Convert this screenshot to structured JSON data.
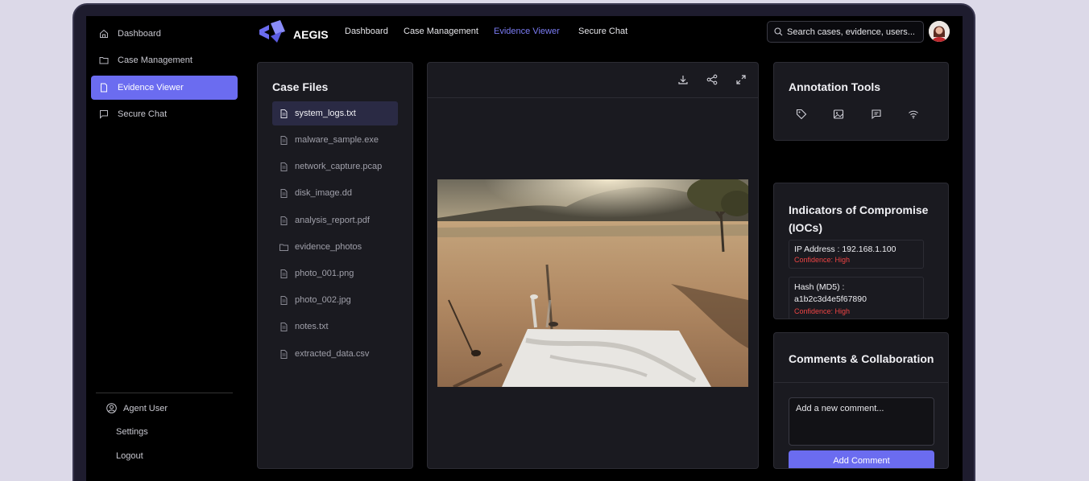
{
  "sidebar": {
    "items": [
      {
        "label": "Dashboard",
        "icon": "home-icon"
      },
      {
        "label": "Case Management",
        "icon": "folder-icon"
      },
      {
        "label": "Evidence Viewer",
        "icon": "file-icon"
      },
      {
        "label": "Secure Chat",
        "icon": "chat-icon"
      }
    ],
    "user": "Agent User",
    "settings": "Settings",
    "logout": "Logout"
  },
  "header": {
    "brand": "AEGIS",
    "nav": [
      "Dashboard",
      "Case Management",
      "Evidence Viewer",
      "Secure Chat"
    ],
    "active_nav": "Evidence Viewer",
    "search_placeholder": "Search cases, evidence, users..."
  },
  "case_files": {
    "title": "Case Files",
    "files": [
      {
        "name": "system_logs.txt",
        "type": "file"
      },
      {
        "name": "malware_sample.exe",
        "type": "file"
      },
      {
        "name": "network_capture.pcap",
        "type": "file"
      },
      {
        "name": "disk_image.dd",
        "type": "file"
      },
      {
        "name": "analysis_report.pdf",
        "type": "file"
      },
      {
        "name": "evidence_photos",
        "type": "folder"
      },
      {
        "name": "photo_001.png",
        "type": "file"
      },
      {
        "name": "photo_002.jpg",
        "type": "file"
      },
      {
        "name": "notes.txt",
        "type": "file"
      },
      {
        "name": "extracted_data.csv",
        "type": "file"
      }
    ]
  },
  "viewer": {
    "actions": [
      "download-icon",
      "share-icon",
      "expand-icon"
    ]
  },
  "annotation": {
    "title": "Annotation Tools",
    "tools": [
      "tag-icon",
      "image-icon",
      "comment-icon",
      "wifi-icon"
    ]
  },
  "iocs": {
    "title": "Indicators of Compromise (IOCs)",
    "items": [
      {
        "label": "IP Address : 192.168.1.100",
        "confidence": "Confidence: High"
      },
      {
        "label": "Hash (MD5) : a1b2c3d4e5f67890",
        "confidence": "Confidence: High"
      }
    ]
  },
  "comments": {
    "title": "Comments & Collaboration",
    "placeholder": "Add a new comment...",
    "button": "Add Comment"
  },
  "colors": {
    "accent": "#6b6cf0",
    "danger": "#ef4444",
    "panel": "#1a1a20",
    "background": "#000000"
  }
}
